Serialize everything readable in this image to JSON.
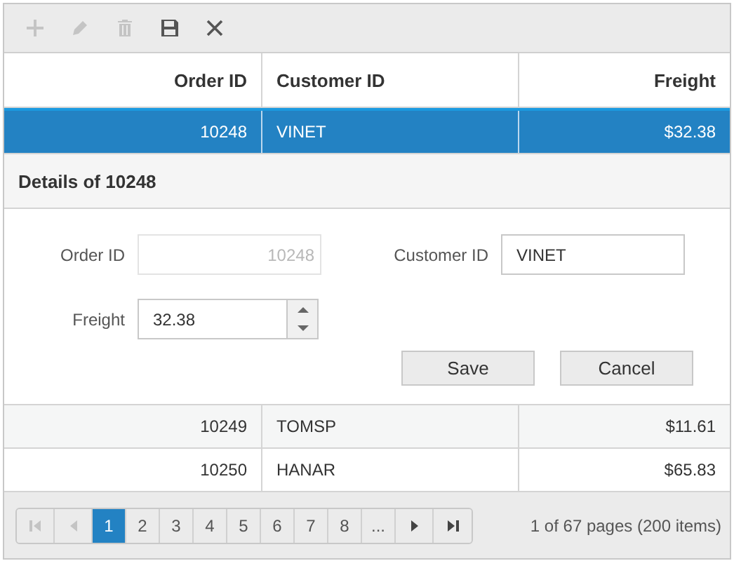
{
  "toolbar": [
    {
      "kind": "add",
      "disabled": true
    },
    {
      "kind": "edit",
      "disabled": true
    },
    {
      "kind": "delete",
      "disabled": true
    },
    {
      "kind": "save",
      "disabled": false
    },
    {
      "kind": "cancel",
      "disabled": false
    }
  ],
  "table": {
    "columns": [
      {
        "label": "Order ID",
        "kind": "numeric"
      },
      {
        "label": "Customer ID",
        "kind": "text"
      },
      {
        "label": "Freight",
        "kind": "numeric"
      }
    ],
    "rows": [
      {
        "cells": [
          "10248",
          "VINET",
          "$32.38"
        ],
        "selected": true
      },
      {
        "cells": [
          "10249",
          "TOMSP",
          "$11.61"
        ],
        "selected": false
      },
      {
        "cells": [
          "10250",
          "HANAR",
          "$65.83"
        ],
        "selected": false
      }
    ]
  },
  "details": {
    "title": "Details of 10248",
    "fields": [
      {
        "label": "Order ID",
        "value": "10248",
        "kind": "text",
        "disabled": true
      },
      {
        "label": "Customer ID",
        "value": "VINET",
        "kind": "text",
        "disabled": false
      },
      {
        "label": "Freight",
        "value": "32.38",
        "kind": "numeric",
        "disabled": false
      }
    ],
    "buttons": [
      "Save",
      "Cancel"
    ]
  },
  "pager": {
    "nav": [
      {
        "kind": "first",
        "disabled": true
      },
      {
        "kind": "prev",
        "disabled": true
      },
      {
        "kind": "next",
        "disabled": false
      },
      {
        "kind": "last",
        "disabled": false
      }
    ],
    "pages": [
      {
        "label": "1",
        "selected": true
      },
      {
        "label": "2",
        "selected": false
      },
      {
        "label": "3",
        "selected": false
      },
      {
        "label": "4",
        "selected": false
      },
      {
        "label": "5",
        "selected": false
      },
      {
        "label": "6",
        "selected": false
      },
      {
        "label": "7",
        "selected": false
      },
      {
        "label": "8",
        "selected": false
      },
      {
        "label": "...",
        "selected": false
      }
    ],
    "info": "1 of 67 pages (200 items)"
  }
}
